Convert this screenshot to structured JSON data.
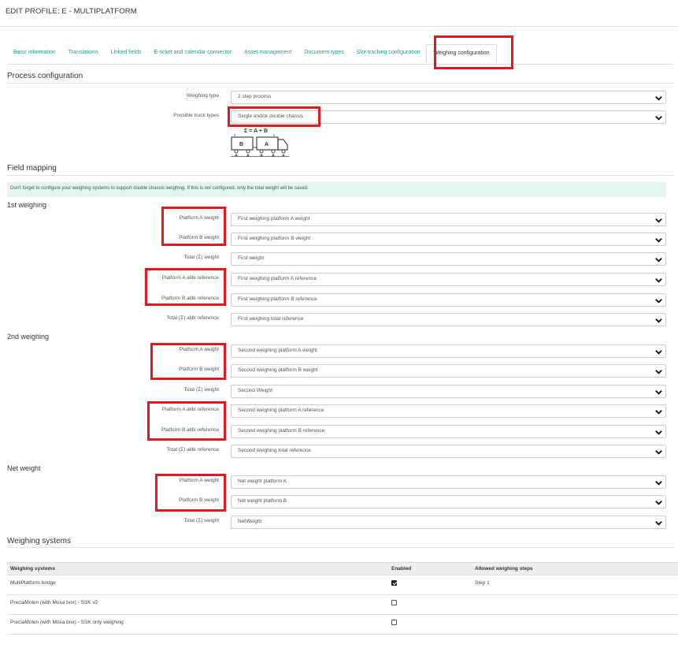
{
  "page": {
    "title": "EDIT PROFILE: E - MULTIPLATFORM"
  },
  "tabs": [
    {
      "label": "Basic information",
      "active": false
    },
    {
      "label": "Translations",
      "active": false
    },
    {
      "label": "Linked fields",
      "active": false
    },
    {
      "label": "E-ticket and calendar connector",
      "active": false
    },
    {
      "label": "Asset management",
      "active": false
    },
    {
      "label": "Document types",
      "active": false
    },
    {
      "label": "Slot tracking configuration",
      "active": false
    },
    {
      "label": "Weighing configuration",
      "active": true
    }
  ],
  "process": {
    "title": "Process configuration",
    "weighing_type": {
      "label": "Weighing type",
      "value": "2 step process"
    },
    "truck_types": {
      "label": "Possible truck types",
      "value": "Single and/or double chassis"
    },
    "diagram": {
      "formula": "Σ = A + B",
      "trailer_b": "B",
      "trailer_a": "A"
    }
  },
  "field_mapping": {
    "title": "Field mapping",
    "info": "Don't forget to configure your weighing systems to support double chassis weighing. If this is not configured, only the total weight will be saved.",
    "first": {
      "title": "1st weighing",
      "platform_a_weight": {
        "label": "Platform A weight",
        "value": "First weighing platform A weight"
      },
      "platform_b_weight": {
        "label": "Platform B weight",
        "value": "First weighing platform B weight"
      },
      "total_weight": {
        "label": "Total (Σ) weight",
        "value": "First weight"
      },
      "platform_a_alibi": {
        "label": "Platform A alibi reference",
        "value": "First weighing platform A reference"
      },
      "platform_b_alibi": {
        "label": "Platform B alibi reference",
        "value": "First weighing platform B reference"
      },
      "total_alibi": {
        "label": "Total (Σ) alibi reference",
        "value": "First weighing total reference"
      }
    },
    "second": {
      "title": "2nd weighing",
      "platform_a_weight": {
        "label": "Platform A weight",
        "value": "Second weighing platform A weight"
      },
      "platform_b_weight": {
        "label": "Platform B weight",
        "value": "Second weighing platform B weight"
      },
      "total_weight": {
        "label": "Total (Σ) weight",
        "value": "Second Weight"
      },
      "platform_a_alibi": {
        "label": "Platform A alibi reference",
        "value": "Second weighing platform A reference"
      },
      "platform_b_alibi": {
        "label": "Platform B alibi reference",
        "value": "Second weighing platform B reference"
      },
      "total_alibi": {
        "label": "Total (Σ) alibi reference",
        "value": "Second weighing total reference"
      }
    },
    "net": {
      "title": "Net weight",
      "platform_a_weight": {
        "label": "Platform A weight",
        "value": "Net weight platform A"
      },
      "platform_b_weight": {
        "label": "Platform B weight",
        "value": "Net weight platform B"
      },
      "total_weight": {
        "label": "Total (Σ) weight",
        "value": "NetWeight"
      }
    }
  },
  "weighing_systems": {
    "title": "Weighing systems",
    "columns": [
      "Weighing systems",
      "Enabled",
      "Allowed weighing steps"
    ],
    "rows": [
      {
        "name": "MultiPlatform bridge",
        "enabled": true,
        "steps": "Step 1"
      },
      {
        "name": "PreciaMolen (with Moxa box) - SSK v2",
        "enabled": false,
        "steps": ""
      },
      {
        "name": "PreciaMolen (with Moxa box) - SSK only weighing",
        "enabled": false,
        "steps": ""
      }
    ]
  },
  "colors": {
    "accent": "#1f9c8c",
    "highlight": "#e0181f",
    "info_bg": "#e3f5ef"
  }
}
